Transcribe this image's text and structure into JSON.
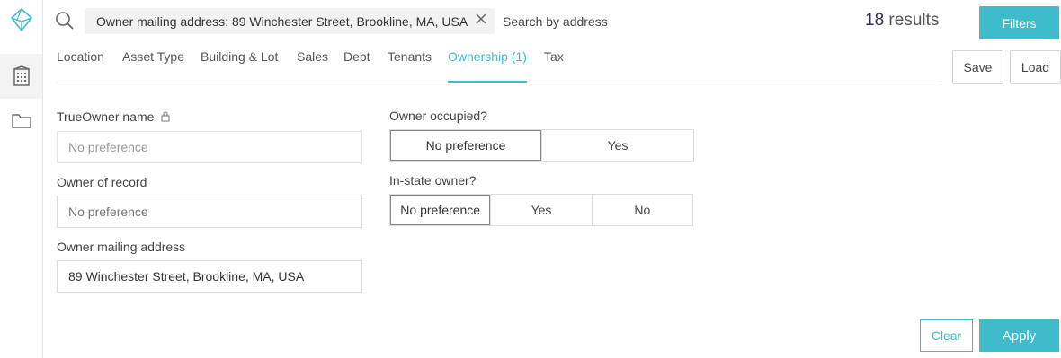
{
  "rail": {
    "icons": [
      "logo-icon",
      "building-icon",
      "folder-icon"
    ]
  },
  "search": {
    "chip_text": "Owner mailing address: 89 Winchester Street, Brookline, MA, USA",
    "placeholder": "Search by address"
  },
  "results": {
    "count": "18",
    "label": "results"
  },
  "toolbar": {
    "filters_label": "Filters",
    "save_label": "Save",
    "load_label": "Load"
  },
  "tabs": [
    {
      "label": "Location"
    },
    {
      "label": "Asset Type"
    },
    {
      "label": "Building & Lot"
    },
    {
      "label": "Sales"
    },
    {
      "label": "Debt"
    },
    {
      "label": "Tenants"
    },
    {
      "label": "Ownership (1)",
      "active": true
    },
    {
      "label": "Tax"
    }
  ],
  "form": {
    "trueowner": {
      "label": "TrueOwner name",
      "placeholder": "No preference"
    },
    "owner_of_record": {
      "label": "Owner of record",
      "placeholder": "No preference"
    },
    "mailing_address": {
      "label": "Owner mailing address",
      "value": "89 Winchester Street, Brookline, MA, USA"
    },
    "owner_occupied": {
      "label": "Owner occupied?",
      "options": [
        "No preference",
        "Yes"
      ],
      "selected": "No preference"
    },
    "in_state_owner": {
      "label": "In-state owner?",
      "options": [
        "No preference",
        "Yes",
        "No"
      ],
      "selected": "No preference"
    }
  },
  "actions": {
    "clear_label": "Clear",
    "apply_label": "Apply"
  },
  "colors": {
    "accent": "#3fbccb",
    "count": "#2b2b66"
  }
}
